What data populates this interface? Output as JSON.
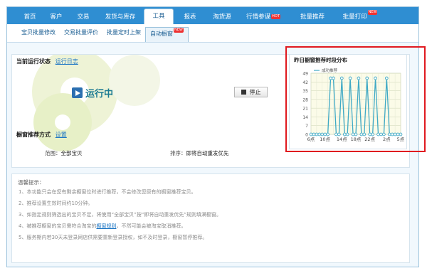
{
  "nav": {
    "items": [
      {
        "label": "首页"
      },
      {
        "label": "客户"
      },
      {
        "label": "交易"
      },
      {
        "label": "发货与库存"
      },
      {
        "label": "工具"
      },
      {
        "label": "报表"
      },
      {
        "label": "淘货源"
      },
      {
        "label": "行情参谋",
        "badge": "HOT"
      },
      {
        "label": "批量推荐"
      },
      {
        "label": "批量打印",
        "badge": "NEW"
      }
    ],
    "active": "工具"
  },
  "subnav": {
    "items": [
      {
        "label": "宝贝批量修改"
      },
      {
        "label": "交易批量评价"
      },
      {
        "label": "批量定时上架"
      },
      {
        "label": "自动橱窗",
        "badge": "NEW"
      }
    ],
    "active": "自动橱窗"
  },
  "status": {
    "label": "当前运行状态",
    "log_link": "运行日志",
    "running_text": "运行中",
    "stop_button": "停止"
  },
  "method": {
    "label": "橱窗推荐方式",
    "settings_link": "设置",
    "scope_label": "范围：",
    "scope_value": "全部宝贝",
    "sort_label": "排序：",
    "sort_value": "即将自动重发优先"
  },
  "chart_data": {
    "type": "line",
    "title": "昨日橱窗推荐时段分布",
    "series": [
      {
        "name": "成功推荐",
        "values": [
          0,
          0,
          0,
          0,
          0,
          0,
          0,
          45,
          45,
          0,
          0,
          45,
          0,
          0,
          45,
          0,
          0,
          45,
          0,
          0,
          45,
          0,
          0,
          45,
          0,
          0,
          0,
          45,
          0,
          0,
          0,
          0,
          0
        ]
      }
    ],
    "x": [
      0,
      1,
      2,
      3,
      4,
      5,
      6,
      7,
      8,
      9,
      10,
      11,
      12,
      13,
      14,
      15,
      16,
      17,
      18,
      19,
      20,
      21,
      22,
      23,
      24,
      25,
      26,
      27,
      28,
      29,
      30,
      31,
      32
    ],
    "xticklabels": [
      "6点",
      "10点",
      "14点",
      "18点",
      "22点",
      "2点",
      "5点"
    ],
    "yticks": [
      0,
      7,
      14,
      21,
      28,
      35,
      42,
      49
    ],
    "ylim": [
      0,
      49
    ],
    "grid": true,
    "legend": "top-left",
    "color": "#3fa9c5"
  },
  "tips": {
    "title": "温馨提示：",
    "lines": [
      "1、本功能只会在您有剩余橱窗位时进行推荐，不会修改您原有的橱窗推荐宝贝。",
      "2、推荐设置生效时间约10分钟。",
      "3、如指定规则筛选出的宝贝不足，将使用“全部宝贝”按“即将自动重发优先”规则填满橱窗。",
      "4、被推荐橱窗的宝贝需符合淘宝的",
      "5、服务期内若30天未登录网店供需要重新登录授权，如不及时登录，橱窗暂停推荐。"
    ],
    "rule_link": "橱窗规则",
    "line4_suffix": "，不然可能会被淘宝取消推荐。"
  },
  "colors": {
    "nav_bg": "#2f8ed2",
    "accent": "#1f77c4",
    "highlight_border": "#e0191f"
  }
}
